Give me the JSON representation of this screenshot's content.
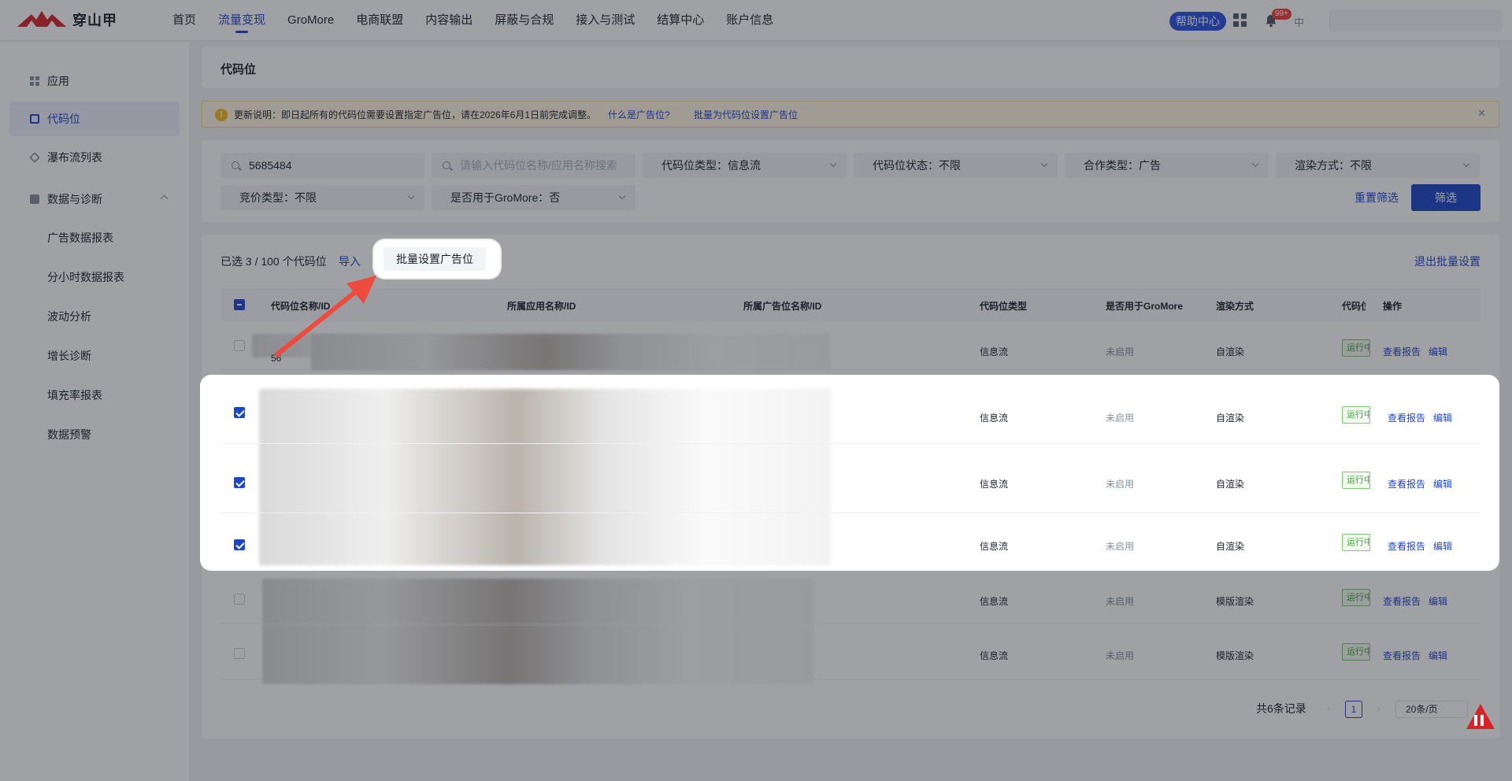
{
  "brand": {
    "name": "穿山甲",
    "accent": "#1e46c8",
    "logo_color": "#d8232a"
  },
  "nav": {
    "items": [
      "首页",
      "流量变现",
      "GroMore",
      "电商联盟",
      "内容输出",
      "屏蔽与合规",
      "接入与测试",
      "结算中心",
      "账户信息"
    ],
    "active": "流量变现",
    "help": "帮助中心",
    "badge": "99+",
    "lang": "中"
  },
  "sidebar": {
    "items": [
      "应用",
      "代码位",
      "瀑布流列表",
      "数据与诊断"
    ],
    "active": "代码位",
    "sub_items": [
      "广告数据报表",
      "分小时数据报表",
      "波动分析",
      "增长诊断",
      "填充率报表",
      "数据预警"
    ]
  },
  "page": {
    "title": "代码位"
  },
  "notice": {
    "text": "更新说明：即日起所有的代码位需要设置指定广告位，请在2026年6月1日前完成调整。",
    "link1": "什么是广告位?",
    "link2": "批量为代码位设置广告位"
  },
  "filters": {
    "id_value": "5685484",
    "name_placeholder": "请输入代码位名称/应用名称搜索",
    "type": "代码位类型：信息流",
    "status": "代码位状态：不限",
    "coop": "合作类型：广告",
    "render": "渲染方式：不限",
    "bid": "竞价类型：不限",
    "gromore": "是否用于GroMore：否",
    "reset": "重置筛选",
    "submit": "筛选"
  },
  "batch": {
    "selected": "已选 3 / 100 个代码位",
    "import": "导入",
    "set_button": "批量设置广告位",
    "exit": "退出批量设置"
  },
  "table": {
    "columns": [
      "代码位名称/ID",
      "所属应用名称/ID",
      "所属广告位名称/ID",
      "代码位类型",
      "是否用于GroMore",
      "渲染方式",
      "代码位",
      "操作"
    ],
    "rows": [
      {
        "checked": false,
        "type": "信息流",
        "gromore": "未启用",
        "render": "自渲染",
        "status": "运行中",
        "name_fragment": "56"
      },
      {
        "checked": true,
        "type": "信息流",
        "gromore": "未启用",
        "render": "自渲染",
        "status": "运行中"
      },
      {
        "checked": true,
        "type": "信息流",
        "gromore": "未启用",
        "render": "自渲染",
        "status": "运行中"
      },
      {
        "checked": true,
        "type": "信息流",
        "gromore": "未启用",
        "render": "自渲染",
        "status": "运行中"
      },
      {
        "checked": false,
        "type": "信息流",
        "gromore": "未启用",
        "render": "模版渲染",
        "status": "运行中"
      },
      {
        "checked": false,
        "type": "信息流",
        "gromore": "未启用",
        "render": "模版渲染",
        "status": "运行中"
      }
    ],
    "op_report": "查看报告",
    "op_edit": "编辑"
  },
  "pagination": {
    "total": "共6条记录",
    "page": "1",
    "size": "20条/页"
  }
}
